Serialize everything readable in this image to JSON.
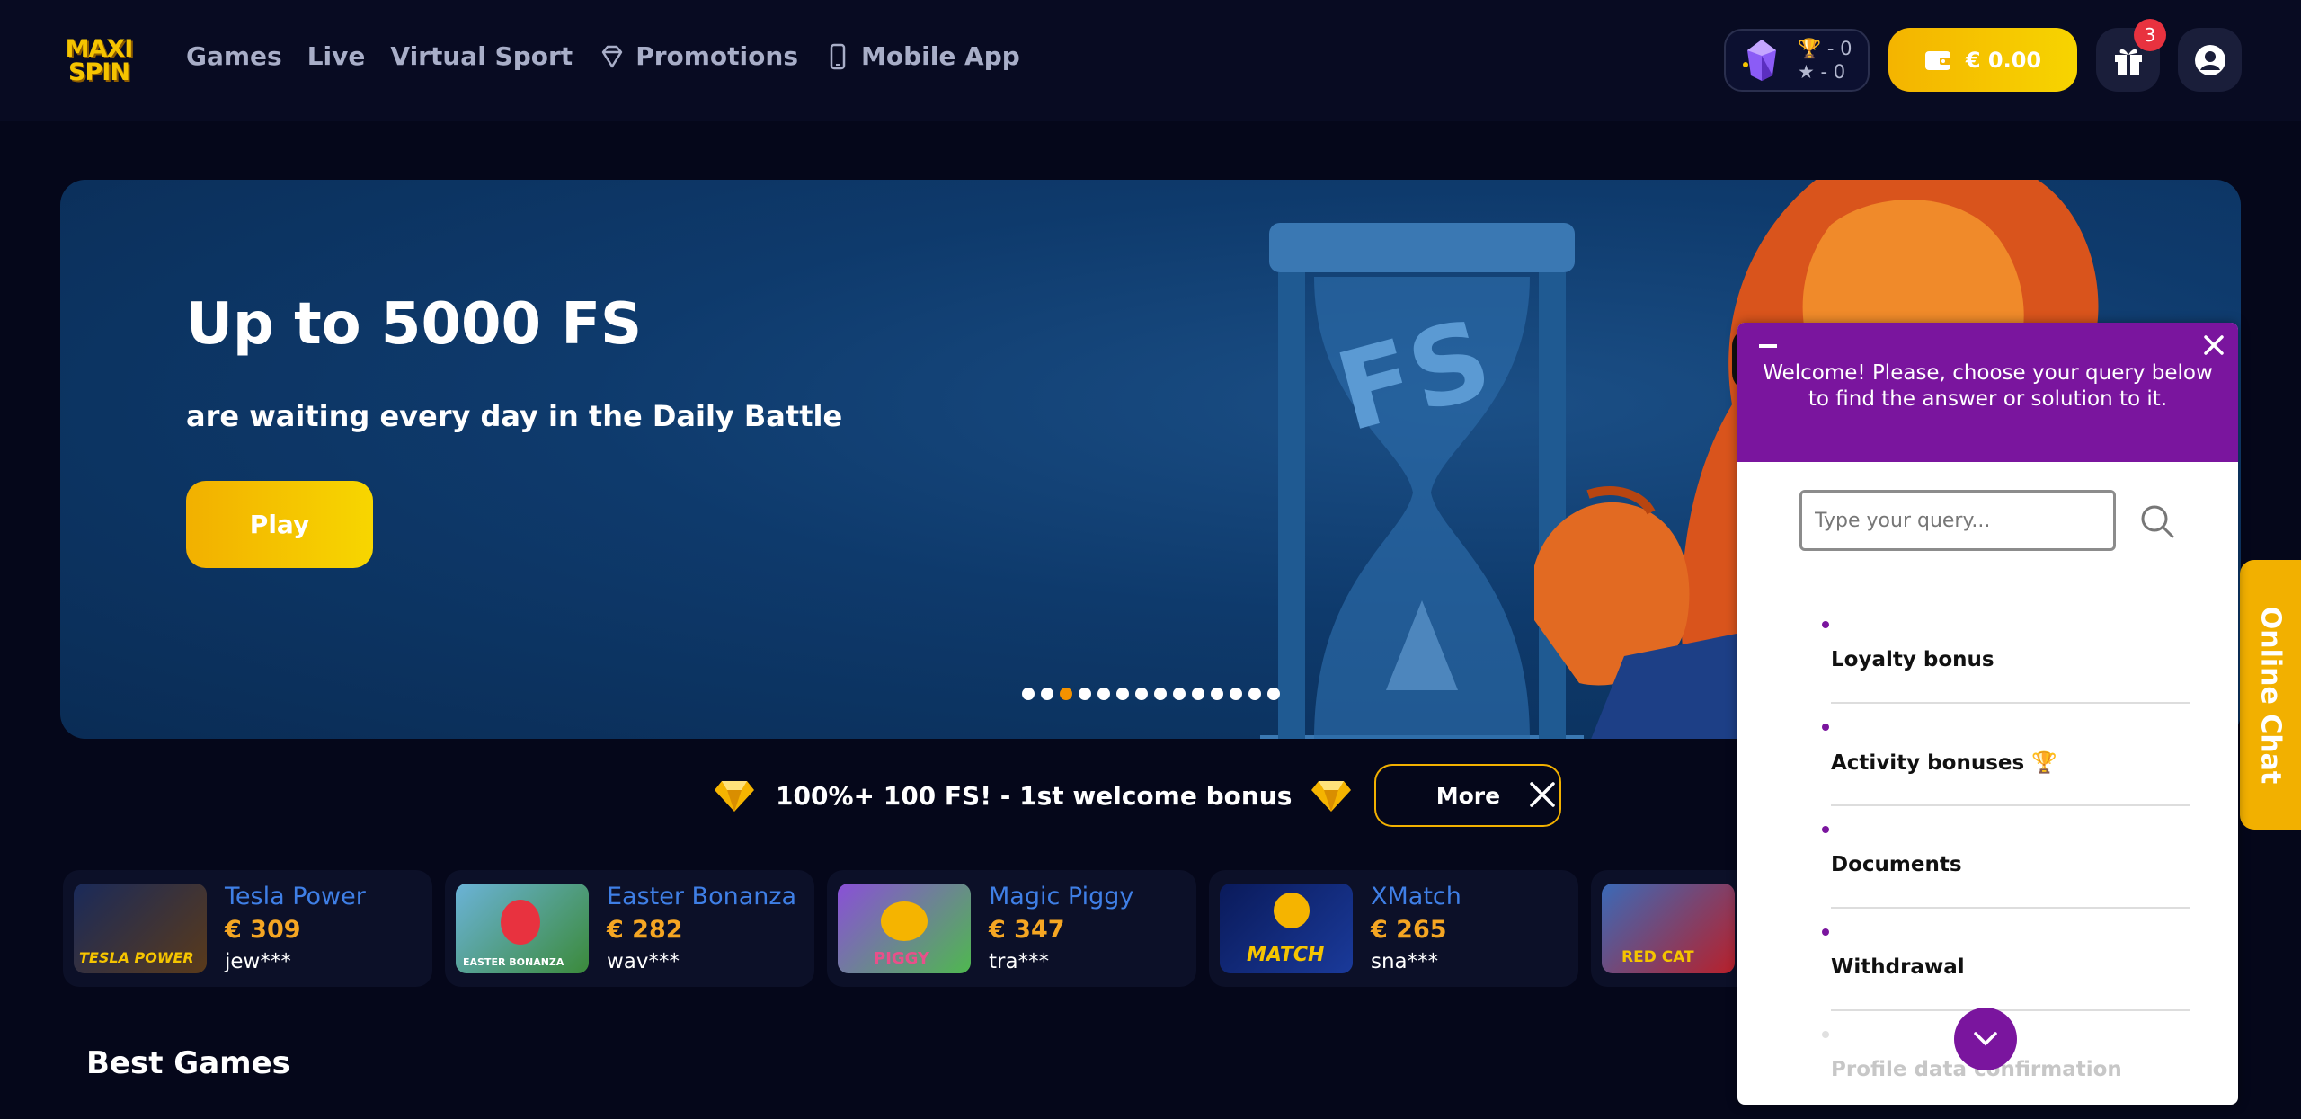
{
  "header": {
    "logo_line1": "MAXI",
    "logo_line2": "SPIN",
    "nav": [
      {
        "label": "Games"
      },
      {
        "label": "Live"
      },
      {
        "label": "Virtual Sport"
      },
      {
        "label": "Promotions"
      },
      {
        "label": "Mobile App"
      }
    ],
    "levels": {
      "trophy_count": "- 0",
      "star_count": "- 0"
    },
    "balance": "€ 0.00",
    "gift_badge": "3",
    "colors": {
      "accent": "#f5c400",
      "badge": "#e8323f"
    }
  },
  "banner": {
    "title": "Up to 5000 FS",
    "subtitle": "are waiting every day in the Daily Battle",
    "play_label": "Play",
    "hourglass_text": "FS",
    "slide_count": 14,
    "active_slide": 3
  },
  "welcome": {
    "text": "100%+ 100 FS! - 1st welcome bonus",
    "more_label": "More"
  },
  "winners": [
    {
      "game": "Tesla Power",
      "amount": "€ 309",
      "user": "jew***",
      "thumb_text": "TESLA POWER"
    },
    {
      "game": "Easter Bonanza",
      "amount": "€ 282",
      "user": "wav***",
      "thumb_text": "EASTER BONANZA"
    },
    {
      "game": "Magic Piggy",
      "amount": "€ 347",
      "user": "tra***",
      "thumb_text": "PIGGY"
    },
    {
      "game": "XMatch",
      "amount": "€ 265",
      "user": "sna***",
      "thumb_text": "MATCH"
    },
    {
      "game": "",
      "amount": "",
      "user": "",
      "thumb_text": "RED CAT"
    }
  ],
  "section_title": "Best Games",
  "chat_tab": "Online Chat",
  "chat": {
    "welcome": "Welcome! Please, choose your query below to find the answer or solution to it.",
    "search_placeholder": "Type your query...",
    "items": [
      {
        "label": "Loyalty bonus"
      },
      {
        "label": "Activity bonuses 🏆"
      },
      {
        "label": "Documents"
      },
      {
        "label": "Withdrawal"
      },
      {
        "label": "Profile data confirmation"
      }
    ],
    "header_color": "#7a159e"
  }
}
